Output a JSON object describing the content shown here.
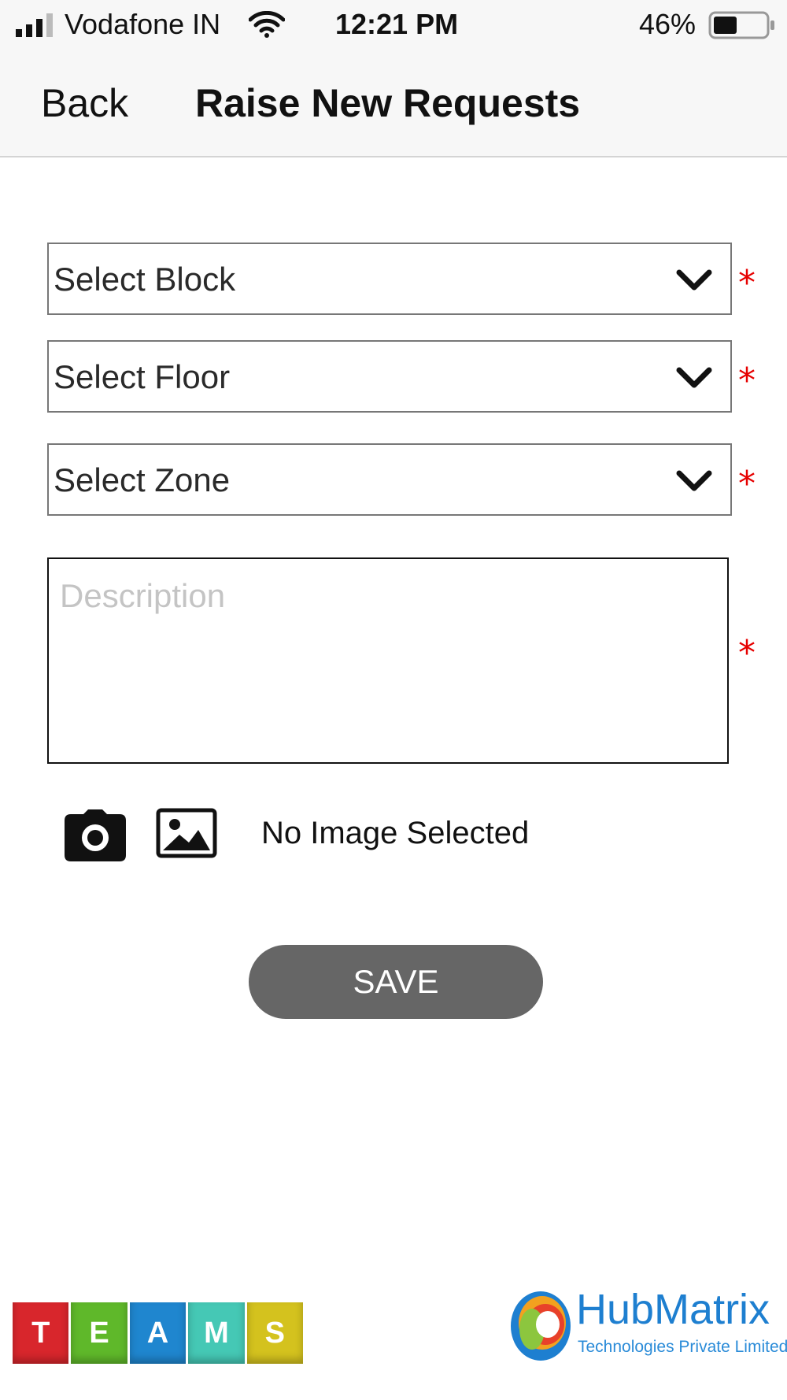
{
  "status_bar": {
    "carrier": "Vodafone IN",
    "time": "12:21 PM",
    "battery_percent": "46%",
    "battery_level": 0.46,
    "icons": [
      "signal-icon",
      "wifi-icon",
      "battery-icon"
    ]
  },
  "nav": {
    "back_label": "Back",
    "title": "Raise New Requests"
  },
  "form": {
    "block": {
      "label": "Select Block",
      "required_mark": "*"
    },
    "floor": {
      "label": "Select Floor",
      "required_mark": "*"
    },
    "zone": {
      "label": "Select Zone",
      "required_mark": "*"
    },
    "description": {
      "placeholder": "Description",
      "value": "",
      "required_mark": "*"
    },
    "image_status": "No Image Selected",
    "icons": [
      "camera-icon",
      "gallery-icon",
      "chevron-down-icon"
    ],
    "save_label": "SAVE"
  },
  "footer": {
    "teams_letters": [
      "T",
      "E",
      "A",
      "M",
      "S"
    ],
    "teams_colors": [
      "#d8262c",
      "#5fb82a",
      "#1f86cf",
      "#45c8b5",
      "#d4c21e"
    ],
    "hub_name": "HubMatrix",
    "hub_subtitle": "Technologies Private Limited"
  },
  "colors": {
    "required": "#e60000",
    "save_button": "#666666",
    "bar_background": "#f7f7f7"
  }
}
